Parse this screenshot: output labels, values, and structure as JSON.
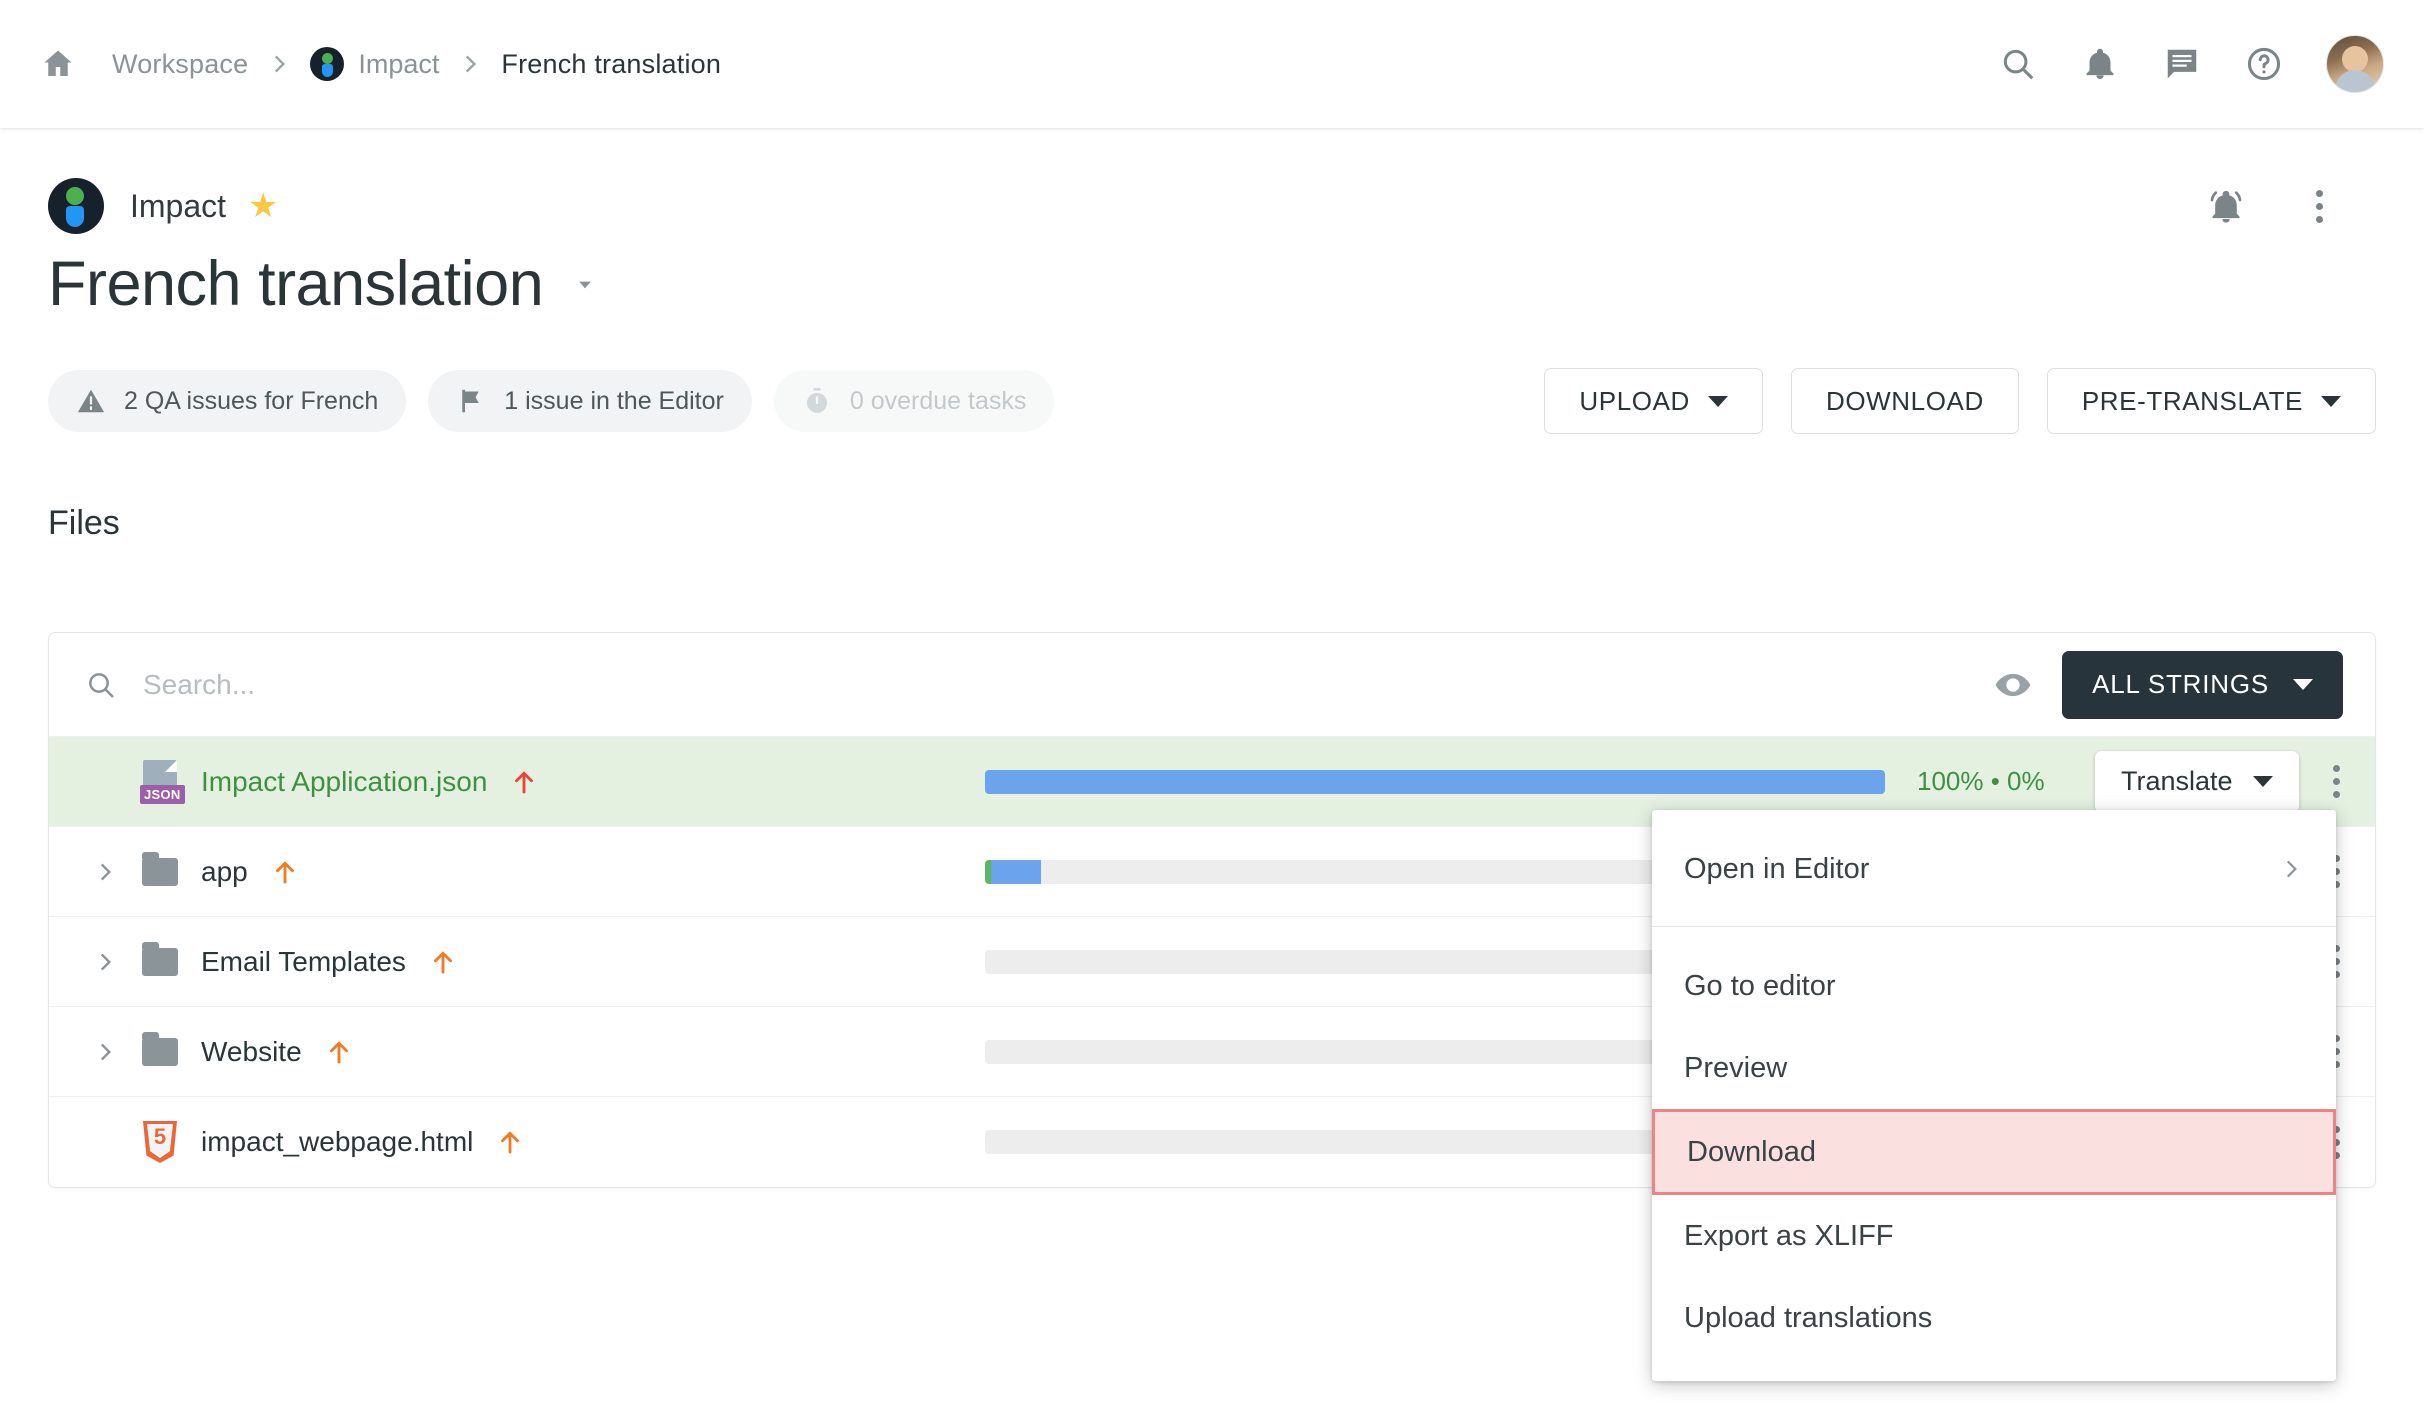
{
  "topnav": {
    "home_icon": "home-icon",
    "breadcrumbs": [
      {
        "label": "Workspace",
        "type": "link"
      },
      {
        "label": "Impact",
        "type": "project"
      },
      {
        "label": "French translation",
        "type": "current"
      }
    ],
    "icons": [
      {
        "name": "search-icon"
      },
      {
        "name": "notifications-bell-icon"
      },
      {
        "name": "chat-message-icon"
      },
      {
        "name": "help-circle-icon"
      }
    ],
    "avatar_alt": "user-avatar"
  },
  "project_header": {
    "project_name": "Impact",
    "star_glyph": "★",
    "page_title": "French translation",
    "notifications_active_icon": "notifications-active-icon",
    "more_options_icon": "more-vertical-icon"
  },
  "chips": [
    {
      "label": "2 QA issues for French",
      "icon": "warning-triangle-icon",
      "muted": false
    },
    {
      "label": "1 issue in the Editor",
      "icon": "flag-icon",
      "muted": false
    },
    {
      "label": "0 overdue tasks",
      "icon": "timer-icon",
      "muted": true
    }
  ],
  "header_buttons": [
    {
      "label": "UPLOAD",
      "has_caret": true
    },
    {
      "label": "DOWNLOAD",
      "has_caret": false
    },
    {
      "label": "PRE-TRANSLATE",
      "has_caret": true
    }
  ],
  "files_section": {
    "heading": "Files",
    "search_placeholder": "Search...",
    "search_value": "",
    "eye_icon": "visibility-eye-icon",
    "filter_button": {
      "label": "ALL STRINGS",
      "has_caret": true
    },
    "rows": [
      {
        "name": "Impact Application.json",
        "type": "json-file",
        "expandable": false,
        "selected": true,
        "upload_arrow": true,
        "progress": [
          {
            "color": "#6ba4ec",
            "percent": 100
          }
        ],
        "percent_text": "100% • 0%",
        "action_button": {
          "label": "Translate",
          "has_caret": true
        }
      },
      {
        "name": "app",
        "type": "folder",
        "expandable": true,
        "selected": false,
        "upload_arrow": true,
        "progress": [
          {
            "color": "#5cb85c",
            "percent": 0.7
          },
          {
            "color": "#6ba4ec",
            "percent": 5.5
          }
        ],
        "percent_text": "",
        "action_button": null
      },
      {
        "name": "Email Templates",
        "type": "folder",
        "expandable": true,
        "selected": false,
        "upload_arrow": true,
        "progress": [],
        "percent_text": "",
        "action_button": null
      },
      {
        "name": "Website",
        "type": "folder",
        "expandable": true,
        "selected": false,
        "upload_arrow": true,
        "progress": [],
        "percent_text": "",
        "action_button": null
      },
      {
        "name": "impact_webpage.html",
        "type": "html-file",
        "expandable": false,
        "selected": false,
        "upload_arrow": true,
        "progress": [],
        "percent_text": "",
        "action_button": null
      }
    ]
  },
  "context_menu": {
    "items": [
      {
        "label": "Open in Editor",
        "submenu": true,
        "highlighted": false,
        "separator_after": true
      },
      {
        "label": "Go to editor",
        "submenu": false,
        "highlighted": false,
        "separator_after": false
      },
      {
        "label": "Preview",
        "submenu": false,
        "highlighted": false,
        "separator_after": false
      },
      {
        "label": "Download",
        "submenu": false,
        "highlighted": true,
        "separator_after": false
      },
      {
        "label": "Export as XLIFF",
        "submenu": false,
        "highlighted": false,
        "separator_after": false
      },
      {
        "label": "Upload translations",
        "submenu": false,
        "highlighted": false,
        "separator_after": false
      }
    ]
  },
  "colors": {
    "selected_row_bg": "#e4f1e1",
    "selected_text": "#3f9142",
    "progress_blue": "#6ba4ec",
    "progress_green": "#5cb85c",
    "highlight_border": "#ef8282",
    "highlight_bg": "#fbe0e0",
    "dark_button": "#27343b",
    "upload_arrow": "#ef7c28",
    "star": "#f7c948"
  }
}
